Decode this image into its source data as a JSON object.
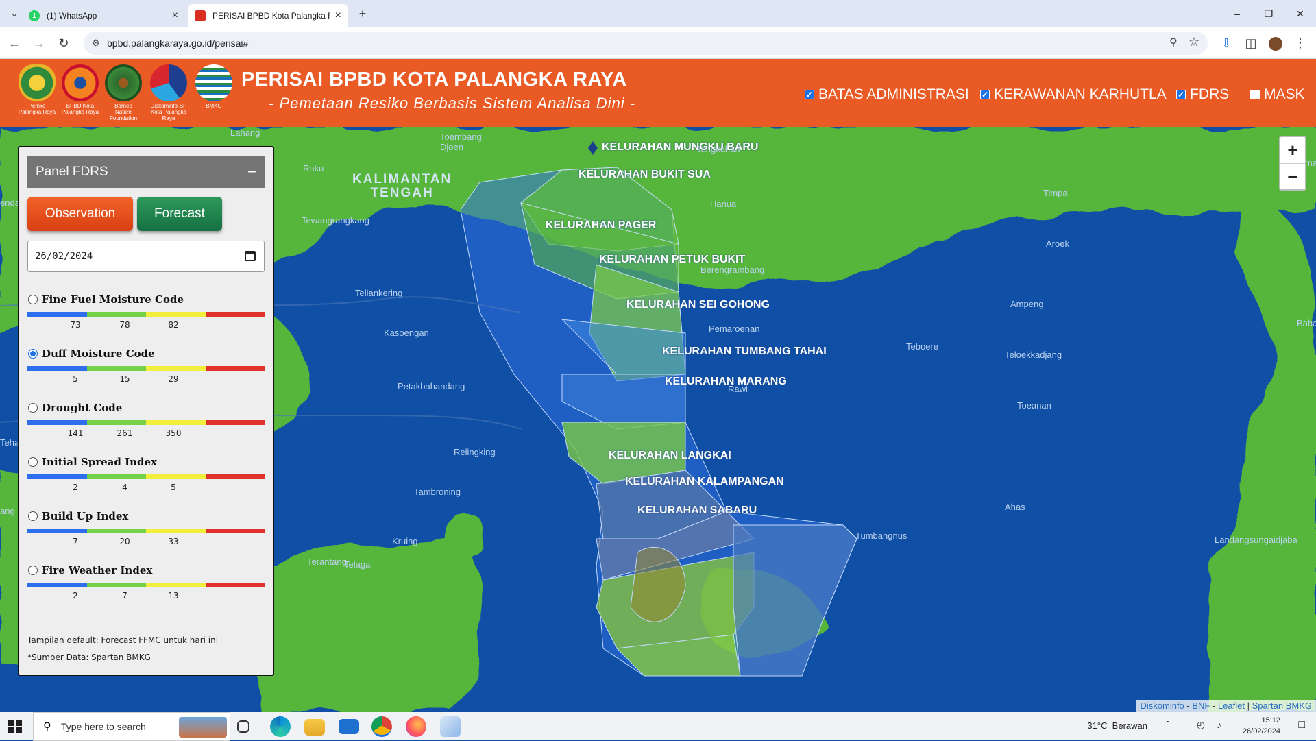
{
  "browser": {
    "tabs": [
      {
        "title": "(1) WhatsApp",
        "badge": "1",
        "active": false
      },
      {
        "title": "PERISAI BPBD Kota Palangka Ra",
        "active": true
      }
    ],
    "url": "bpbd.palangkaraya.go.id/perisai#"
  },
  "header": {
    "title": "PERISAI BPBD KOTA PALANGKA RAYA",
    "subtitle": "- Pemetaan Resiko Berbasis Sistem Analisa Dini -",
    "logos": [
      {
        "caption": "Pemko\nPalangka Raya"
      },
      {
        "caption": "BPBD Kota\nPalangka Raya"
      },
      {
        "caption": "Borneo\nNature\nFoundation"
      },
      {
        "caption": "Diskominfo-SP\nKota Palangka Raya"
      },
      {
        "caption": "BMKG"
      }
    ],
    "layers": [
      {
        "label": "BATAS ADMINISTRASI",
        "checked": true
      },
      {
        "label": "KERAWANAN KARHUTLA",
        "checked": true
      },
      {
        "label": "FDRS",
        "checked": true
      },
      {
        "label": "MASK",
        "checked": false
      }
    ]
  },
  "panel": {
    "title": "Panel FDRS",
    "collapse": "−",
    "observation_label": "Observation",
    "forecast_label": "Forecast",
    "date_value": "26/02/2024",
    "indices": [
      {
        "label": "Fine Fuel Moisture Code",
        "selected": false,
        "ticks": [
          "73",
          "78",
          "82"
        ]
      },
      {
        "label": "Duff Moisture Code",
        "selected": true,
        "ticks": [
          "5",
          "15",
          "29"
        ]
      },
      {
        "label": "Drought Code",
        "selected": false,
        "ticks": [
          "141",
          "261",
          "350"
        ]
      },
      {
        "label": "Initial Spread Index",
        "selected": false,
        "ticks": [
          "2",
          "4",
          "5"
        ]
      },
      {
        "label": "Build Up Index",
        "selected": false,
        "ticks": [
          "7",
          "20",
          "33"
        ]
      },
      {
        "label": "Fire Weather Index",
        "selected": false,
        "ticks": [
          "2",
          "7",
          "13"
        ]
      }
    ],
    "scale_colors": [
      "#2e6ff0",
      "#76d14a",
      "#f1ee3c",
      "#e0312b"
    ],
    "note": "Tampilan default: Forecast FFMC untuk hari ini",
    "source": "*Sumber Data: Spartan BMKG"
  },
  "map": {
    "region_label": "KALIMANTAN\nTENGAH",
    "places": [
      "Lahang",
      "Toembang\nDjoen",
      "Tangkahan",
      "Raku",
      "Pama",
      "Tewangrangkang",
      "Hanua",
      "Timpa",
      "Aroek",
      "Berengrambang",
      "Teliankering",
      "Ampeng",
      "Kasoengan",
      "Pemaroenan",
      "Teboere",
      "Teloekkadjang",
      "Baba",
      "Petakbahandang",
      "Rawi",
      "Toeanan",
      "Relingking",
      "Tambroning",
      "Ahas",
      "Kruing",
      "Tumbangnus",
      "Landangsungaidjaba",
      "Terantang",
      "Telaga",
      "enda",
      "Teha",
      "ang"
    ],
    "kelurahan": [
      "KELURAHAN MUNGKU BARU",
      "KELURAHAN BUKIT SUA",
      "KELURAHAN PAGER",
      "KELURAHAN PETUK BUKIT",
      "KELURAHAN SEI GOHONG",
      "KELURAHAN TUMBANG TAHAI",
      "KELURAHAN MARANG",
      "KELURAHAN LANGKAI",
      "KELURAHAN KALAMPANGAN",
      "KELURAHAN SABARU"
    ],
    "zoom_in": "+",
    "zoom_out": "−",
    "attribution": [
      "Diskominfo",
      "BNF",
      "Leaflet",
      "Spartan BMKG"
    ]
  },
  "taskbar": {
    "search_placeholder": "Type here to search",
    "weather": "31°C  Berawan",
    "time": "15:12",
    "date": "26/02/2024"
  }
}
